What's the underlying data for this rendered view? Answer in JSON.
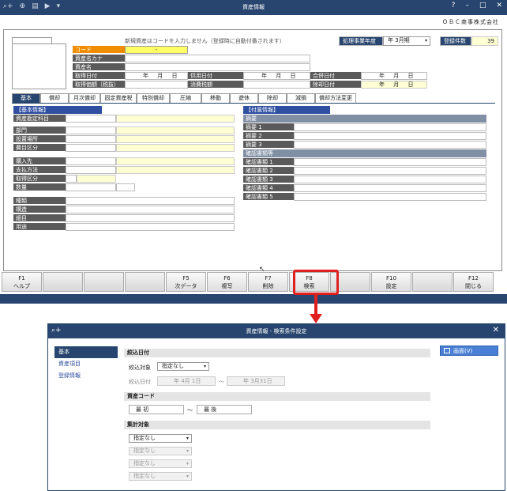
{
  "main_window": {
    "title": "資産情報",
    "company": "ＯＢＣ商事株式会社",
    "hint": "新規資産はコードを入力しません（登録時に自動付番されます）",
    "fiscal_label": "処理事業年度",
    "fiscal_value": "年 3月期",
    "count_label": "登録件数",
    "count_value": "39",
    "header_fields": {
      "code": "コード",
      "code_value": "-",
      "kana": "資産名カナ",
      "name": "資産名",
      "acq_date": "取得日付",
      "acq_cost": "取得価額（税抜）",
      "use_date": "供用日付",
      "tax_cat": "消費税額",
      "merge_date": "合併日付",
      "disposal_date": "除却日付",
      "date_text": "年 月 日"
    },
    "tabs": [
      "基本",
      "償却",
      "月次償却",
      "固定資産税",
      "特別償却",
      "圧縮",
      "移動",
      "遊休",
      "除却",
      "減損",
      "償却方法変更"
    ],
    "basic_section": "【基本情報】",
    "basic_rows_1": [
      "資産勘定科目"
    ],
    "basic_rows_2": [
      "部門",
      "設置場所",
      "費目区分"
    ],
    "basic_rows_3": [
      "購入先",
      "支払方法",
      "取得区分",
      "数量"
    ],
    "basic_rows_4": [
      "種類",
      "構造",
      "細目",
      "用途"
    ],
    "attach_section": "【付属情報】",
    "memo_header": "摘要",
    "memo_rows": [
      "摘要 1",
      "摘要 2",
      "摘要 3"
    ],
    "doc_header": "確認書類等",
    "doc_rows": [
      "確認書類 1",
      "確認書類 2",
      "確認書類 3",
      "確認書類 4",
      "確認書類 5"
    ]
  },
  "fkeys": [
    {
      "key": "F1",
      "label": "ヘルプ"
    },
    {
      "key": "",
      "label": ""
    },
    {
      "key": "",
      "label": ""
    },
    {
      "key": "",
      "label": ""
    },
    {
      "key": "F5",
      "label": "次データ"
    },
    {
      "key": "F6",
      "label": "複写"
    },
    {
      "key": "F7",
      "label": "削除"
    },
    {
      "key": "F8",
      "label": "検索"
    },
    {
      "key": "",
      "label": ""
    },
    {
      "key": "F10",
      "label": "設定"
    },
    {
      "key": "",
      "label": ""
    },
    {
      "key": "F12",
      "label": "閉じる"
    }
  ],
  "search_window": {
    "title": "資産情報 - 検索条件設定",
    "side_items": [
      "基本",
      "資産項目",
      "登録情報"
    ],
    "screen_button": "画面(V)",
    "sec_acq": "絞込日付",
    "filter_label": "絞込対象",
    "filter_value": "指定なし",
    "date_label": "絞込日付",
    "date_from": "年 4月 1日",
    "date_to": "年 3月31日",
    "tilde": "～",
    "sec_code": "資産コード",
    "code_from": "最 初",
    "code_to": "最 後",
    "sec_agg": "集計対象",
    "agg_values": [
      "指定なし",
      "指定なし",
      "指定なし",
      "指定なし"
    ]
  }
}
